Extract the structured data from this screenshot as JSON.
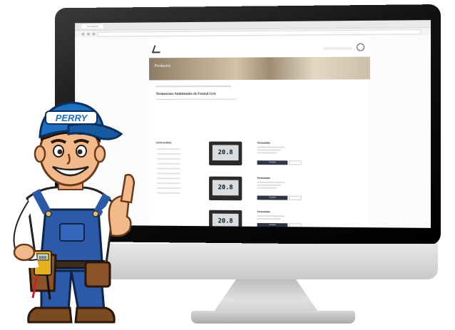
{
  "browser": {
    "tab_label": "Termostatos"
  },
  "site": {
    "banner_title": "Productos",
    "page_heading": "Termostatos Ambientales de Frontal Gris",
    "sidebar_title": "CATEGORÍAS",
    "products": [
      {
        "title": "Termostato",
        "display": "20.8",
        "buy_label": "Comprar"
      },
      {
        "title": "Termostato",
        "display": "20.8",
        "buy_label": "Comprar"
      },
      {
        "title": "Termostato",
        "display": "20.8",
        "buy_label": "Comprar"
      }
    ]
  },
  "mascot": {
    "cap_text": "PERRY",
    "meter_display": "888"
  },
  "colors": {
    "overalls": "#2c5aa8",
    "cap": "#1d6fc2",
    "shirt": "#ffffff",
    "skin": "#f2b98a",
    "hair": "#3b2414"
  }
}
